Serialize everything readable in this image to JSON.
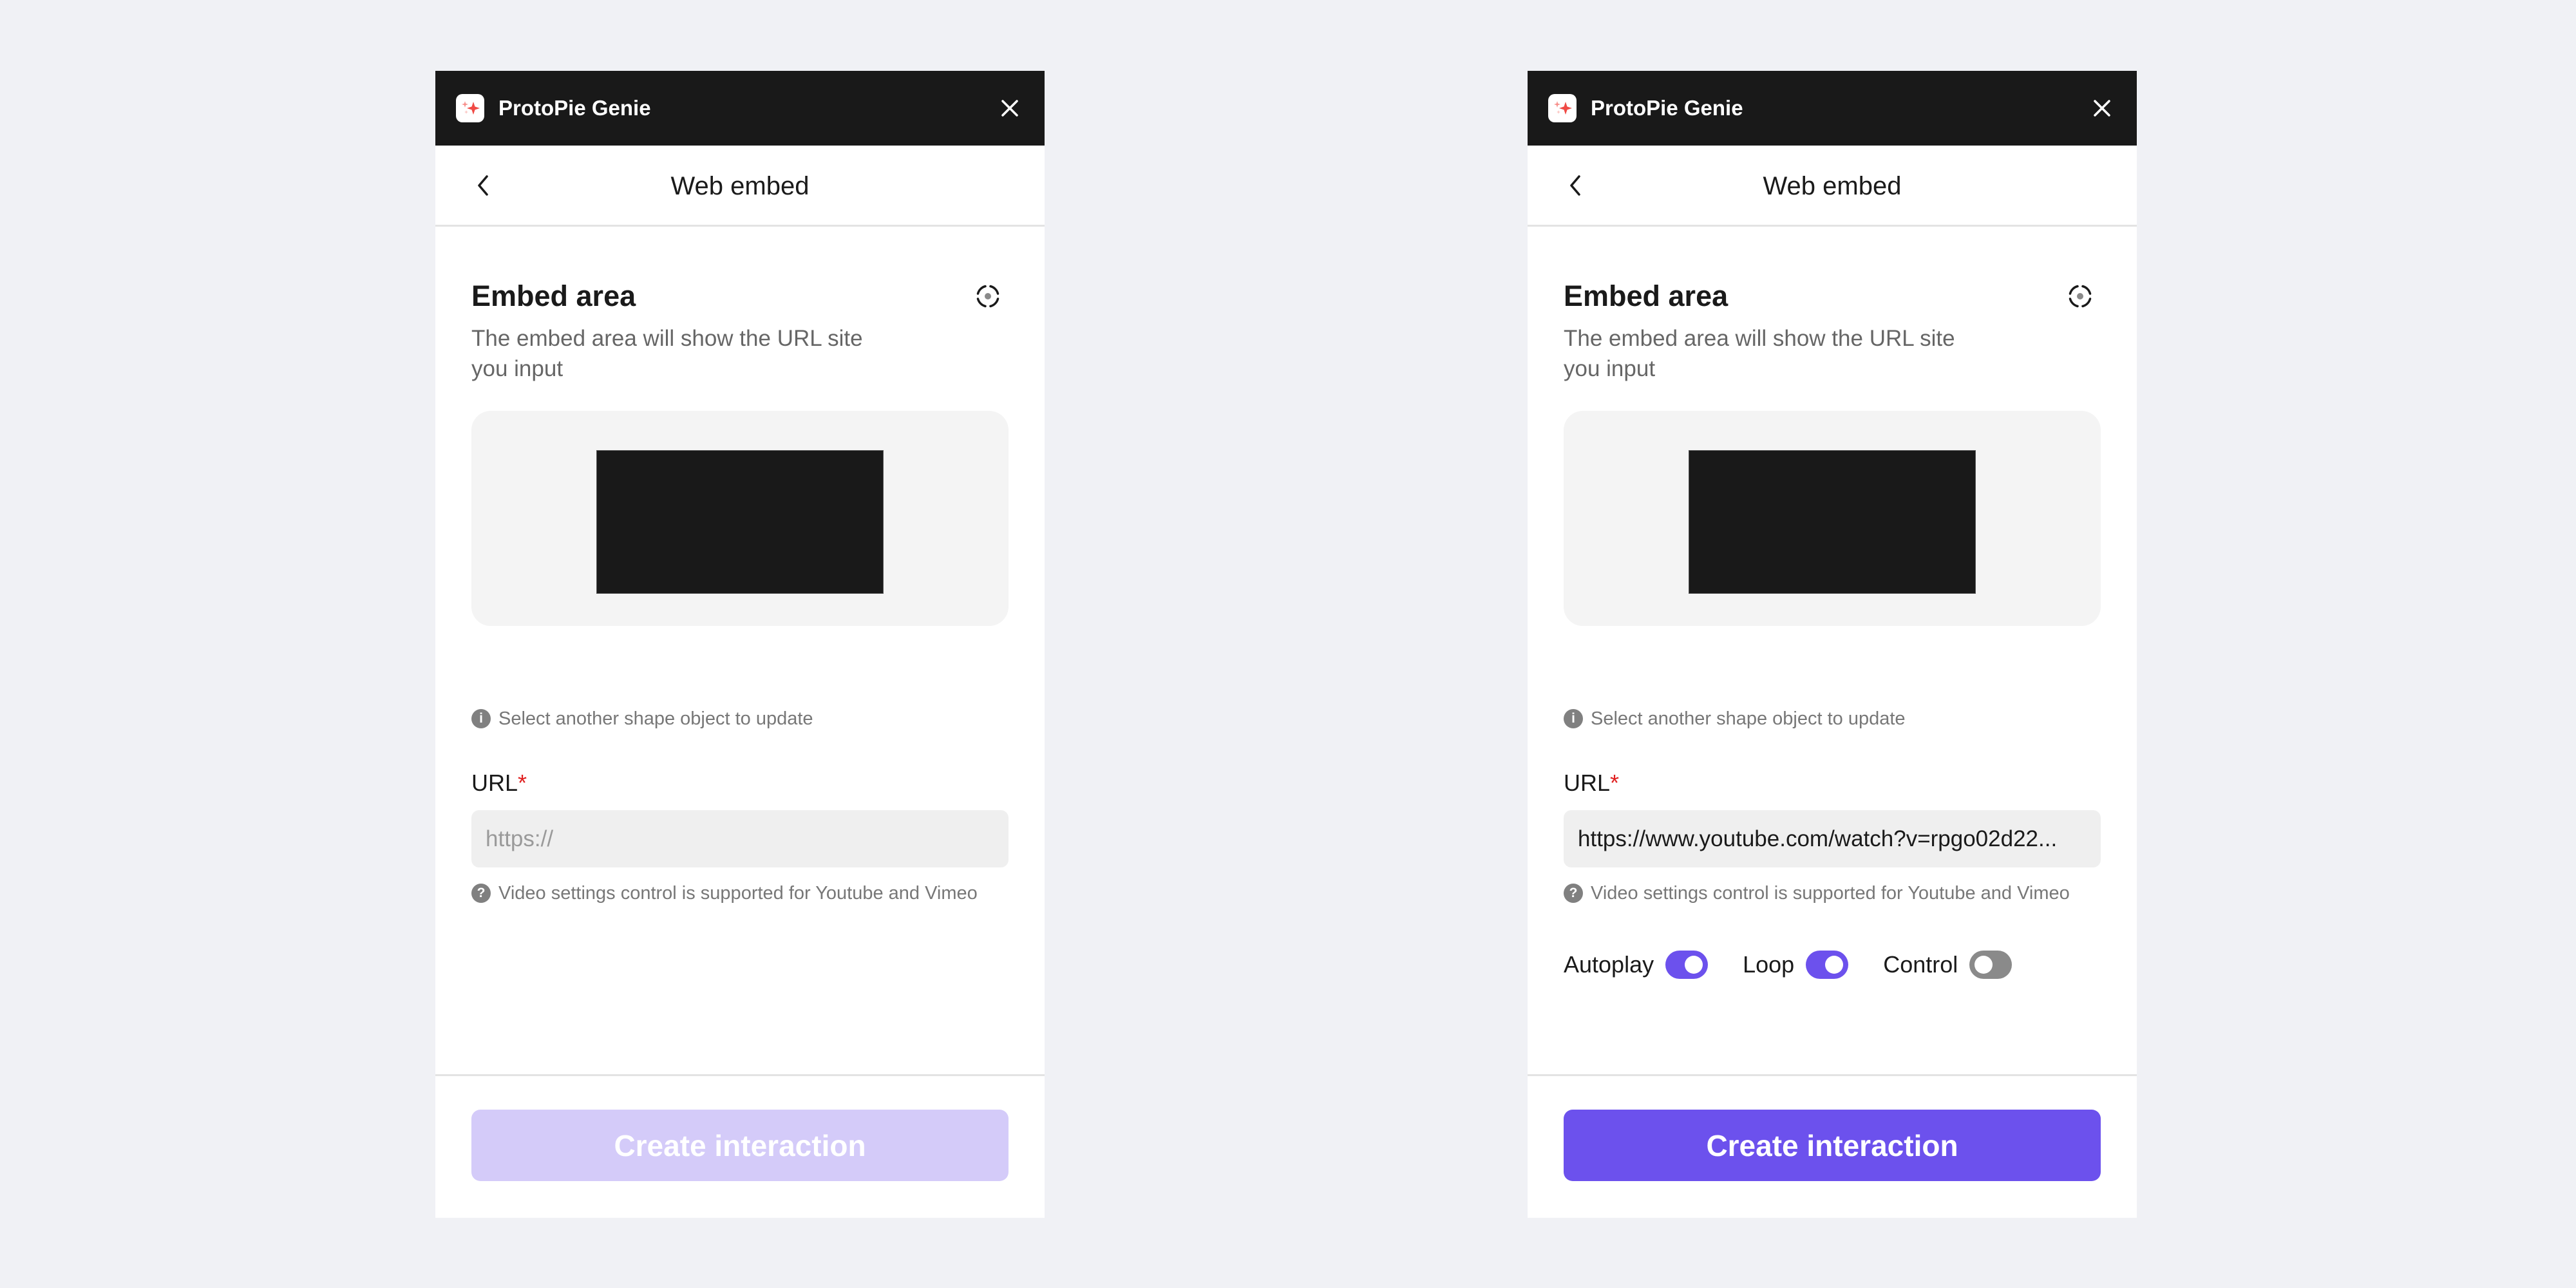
{
  "colors": {
    "background": "#f0f1f5",
    "titlebar": "#191919",
    "accent": "#6c51ed",
    "accent_disabled": "#d4cbf9",
    "toggle_off": "#8a8a8a",
    "required": "#e02020"
  },
  "panels": [
    {
      "state": "empty",
      "titlebar": {
        "app_name": "ProtoPie Genie",
        "logo_icon": "sparkle-icon",
        "close_icon": "close-icon"
      },
      "header": {
        "back_icon": "chevron-left-icon",
        "title": "Web embed"
      },
      "embed_area": {
        "title": "Embed area",
        "target_icon": "target-icon",
        "description": "The embed area will show the URL site you input",
        "hint": "Select another shape object to update",
        "hint_icon": "info-icon"
      },
      "url": {
        "label": "URL",
        "required_mark": "*",
        "value": "",
        "placeholder": "https://",
        "help": "Video settings control is supported for Youtube and Vimeo",
        "help_icon": "question-icon"
      },
      "toggles": [],
      "button": {
        "label": "Create interaction",
        "enabled": false
      }
    },
    {
      "state": "filled",
      "titlebar": {
        "app_name": "ProtoPie Genie",
        "logo_icon": "sparkle-icon",
        "close_icon": "close-icon"
      },
      "header": {
        "back_icon": "chevron-left-icon",
        "title": "Web embed"
      },
      "embed_area": {
        "title": "Embed area",
        "target_icon": "target-icon",
        "description": "The embed area will show the URL site you input",
        "hint": "Select another shape object to update",
        "hint_icon": "info-icon"
      },
      "url": {
        "label": "URL",
        "required_mark": "*",
        "value": "https://www.youtube.com/watch?v=rpgo02d22...",
        "placeholder": "https://",
        "help": "Video settings control is supported for Youtube and Vimeo",
        "help_icon": "question-icon"
      },
      "toggles": [
        {
          "label": "Autoplay",
          "on": true
        },
        {
          "label": "Loop",
          "on": true
        },
        {
          "label": "Control",
          "on": false
        }
      ],
      "button": {
        "label": "Create interaction",
        "enabled": true
      }
    }
  ]
}
